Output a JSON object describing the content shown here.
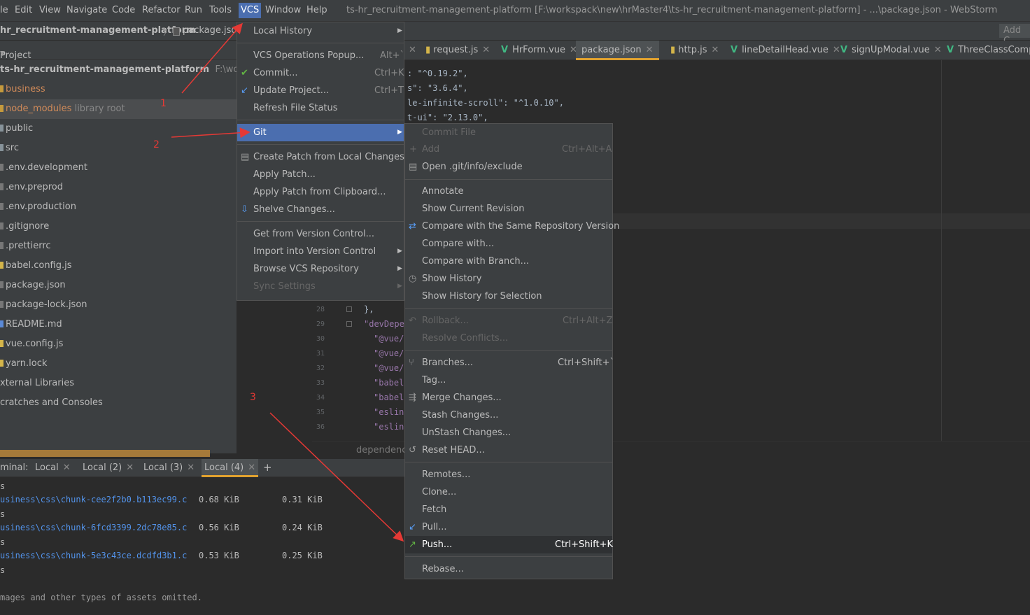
{
  "window": {
    "title": "ts-hr_recruitment-management-platform [F:\\workspack\\new\\hrMaster4\\ts-hr_recruitment-management-platform] - ...\\package.json - WebStorm"
  },
  "menubar": {
    "items": [
      "le",
      "Edit",
      "View",
      "Navigate",
      "Code",
      "Refactor",
      "Run",
      "Tools",
      "VCS",
      "Window",
      "Help"
    ]
  },
  "breadcrumb": {
    "project": "hr_recruitment-management-platform",
    "file": "package.json",
    "add_button": "Add C"
  },
  "project_panel": {
    "header": "Project",
    "root": {
      "name": "ts-hr_recruitment-management-platform",
      "path": "F:\\workspack\\n"
    },
    "items": [
      {
        "name": "business"
      },
      {
        "name": "node_modules",
        "extra": "library root"
      },
      {
        "name": "public"
      },
      {
        "name": "src"
      },
      {
        "name": ".env.development"
      },
      {
        "name": ".env.preprod"
      },
      {
        "name": ".env.production"
      },
      {
        "name": ".gitignore"
      },
      {
        "name": ".prettierrc"
      },
      {
        "name": "babel.config.js"
      },
      {
        "name": "package.json"
      },
      {
        "name": "package-lock.json"
      },
      {
        "name": "README.md"
      },
      {
        "name": "vue.config.js"
      },
      {
        "name": "yarn.lock"
      },
      {
        "name": "xternal Libraries"
      },
      {
        "name": "cratches and Consoles"
      }
    ]
  },
  "editor_tabs": [
    "request.js",
    "HrForm.vue",
    "package.json",
    "http.js",
    "lineDetailHead.vue",
    "signUpModal.vue",
    "ThreeClassComp."
  ],
  "editor_code": [
    ": \"^0.19.2\",",
    "s\": \"3.6.4\",",
    "le-infinite-scroll\": \"^1.0.10\",",
    "t-ui\": \"2.13.0\","
  ],
  "gutter": {
    "lines": [
      "28",
      "29",
      "30",
      "31",
      "32",
      "33",
      "34",
      "35",
      "36"
    ],
    "code": [
      "},",
      "\"devDeper",
      "\"@vue/c",
      "\"@vue/c",
      "\"@vue/c",
      "\"babel-",
      "\"babel-",
      "\"eslint",
      "\"eslint"
    ],
    "footer": "dependencie"
  },
  "terminal": {
    "label": "minal:",
    "tabs": [
      "Local",
      "Local (2)",
      "Local (3)",
      "Local (4)"
    ],
    "add": "+",
    "lines": [
      {
        "path": "usiness\\css\\chunk-cee2f2b0.b113ec99.c",
        "size": "0.68 KiB",
        "gz": "0.31 KiB"
      },
      {
        "path": "usiness\\css\\chunk-6fcd3399.2dc78e85.c",
        "size": "0.56 KiB",
        "gz": "0.24 KiB"
      },
      {
        "path": "usiness\\css\\chunk-5e3c43ce.dcdfd3b1.c",
        "size": "0.53 KiB",
        "gz": "0.25 KiB"
      }
    ],
    "footer": "mages and other types of assets omitted."
  },
  "vcs_menu": [
    {
      "label": "Local History",
      "arrow": true
    },
    {
      "label": "VCS Operations Popup...",
      "shortcut": "Alt+`"
    },
    {
      "label": "Commit...",
      "shortcut": "Ctrl+K",
      "icon": "check"
    },
    {
      "label": "Update Project...",
      "shortcut": "Ctrl+T",
      "icon": "update"
    },
    {
      "label": "Refresh File Status"
    },
    {
      "label": "Git",
      "arrow": true
    },
    {
      "label": "Create Patch from Local Changes..."
    },
    {
      "label": "Apply Patch..."
    },
    {
      "label": "Apply Patch from Clipboard..."
    },
    {
      "label": "Shelve Changes..."
    },
    {
      "label": "Get from Version Control..."
    },
    {
      "label": "Import into Version Control",
      "arrow": true
    },
    {
      "label": "Browse VCS Repository",
      "arrow": true
    },
    {
      "label": "Sync Settings",
      "arrow": true
    }
  ],
  "git_menu": [
    {
      "label": "Commit File"
    },
    {
      "label": "Add",
      "shortcut": "Ctrl+Alt+A"
    },
    {
      "label": "Open .git/info/exclude"
    },
    {
      "label": "Annotate"
    },
    {
      "label": "Show Current Revision"
    },
    {
      "label": "Compare with the Same Repository Version"
    },
    {
      "label": "Compare with..."
    },
    {
      "label": "Compare with Branch..."
    },
    {
      "label": "Show History"
    },
    {
      "label": "Show History for Selection"
    },
    {
      "label": "Rollback...",
      "shortcut": "Ctrl+Alt+Z"
    },
    {
      "label": "Resolve Conflicts..."
    },
    {
      "label": "Branches...",
      "shortcut": "Ctrl+Shift+`"
    },
    {
      "label": "Tag..."
    },
    {
      "label": "Merge Changes..."
    },
    {
      "label": "Stash Changes..."
    },
    {
      "label": "UnStash Changes..."
    },
    {
      "label": "Reset HEAD..."
    },
    {
      "label": "Remotes..."
    },
    {
      "label": "Clone..."
    },
    {
      "label": "Fetch"
    },
    {
      "label": "Pull..."
    },
    {
      "label": "Push...",
      "shortcut": "Ctrl+Shift+K"
    },
    {
      "label": "Rebase..."
    }
  ],
  "annotations": [
    "1",
    "2",
    "3"
  ],
  "colors": {
    "accent": "#4b6eaf",
    "annotation": "#e53935",
    "active_tab": "#e0a12f",
    "vue": "#41b883"
  }
}
